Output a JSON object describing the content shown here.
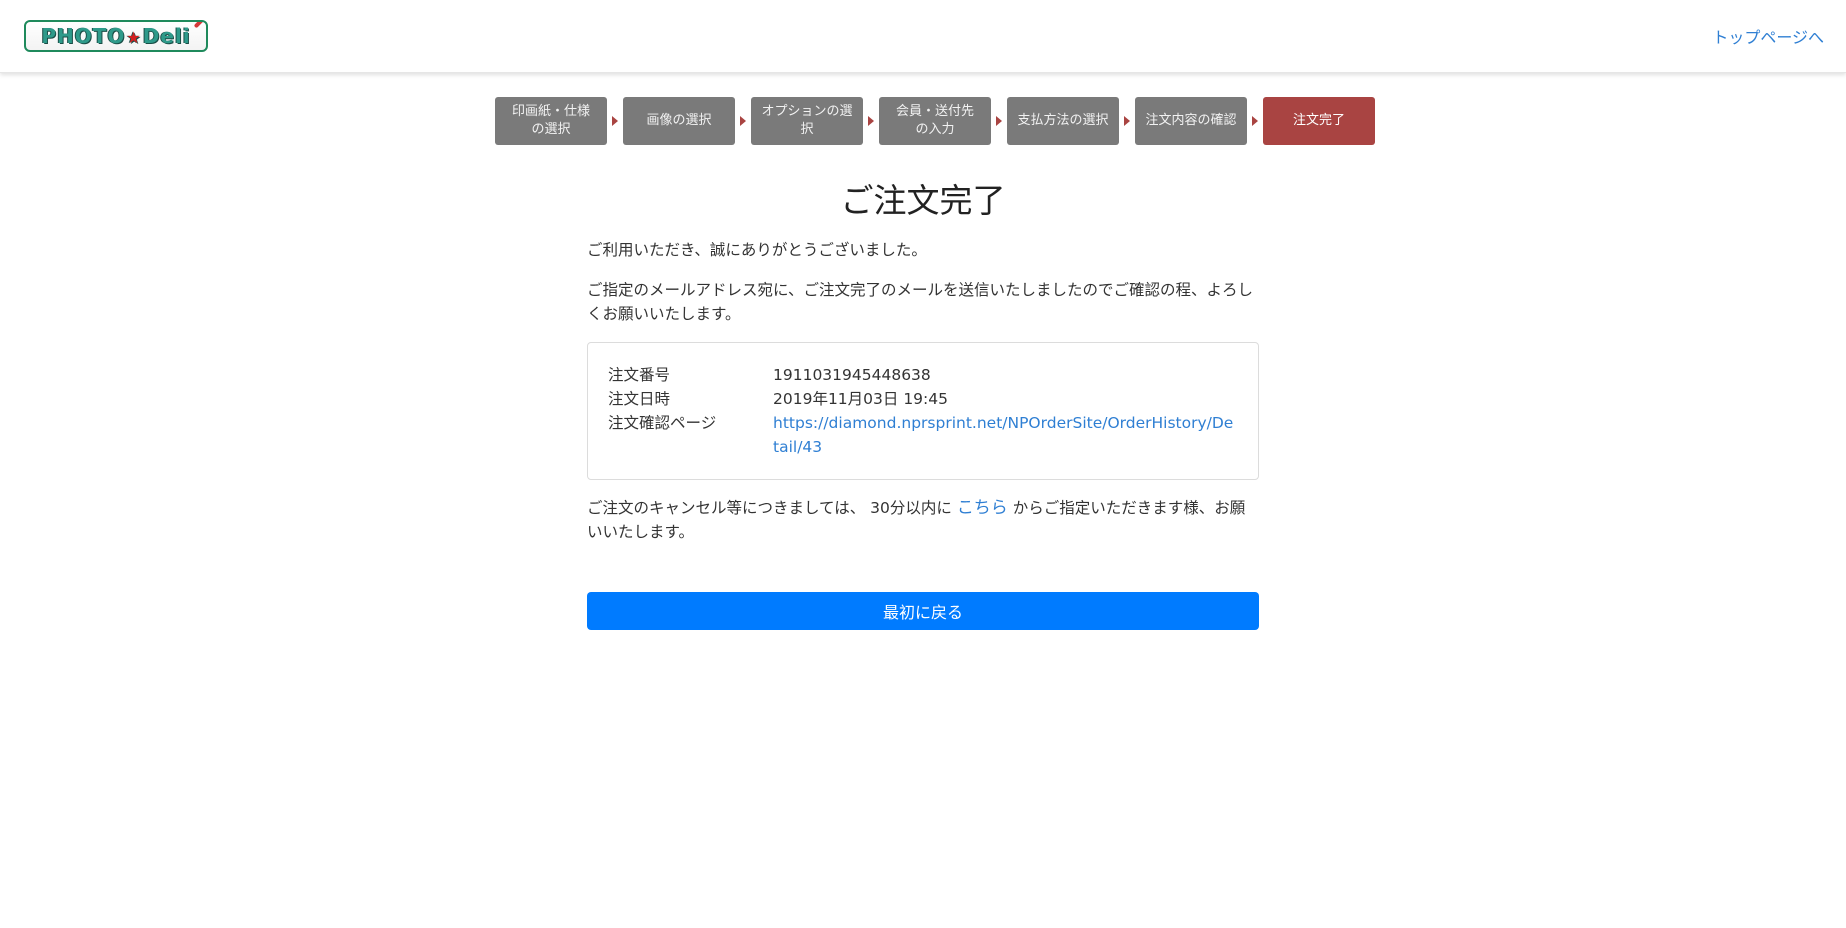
{
  "header": {
    "logo": {
      "text_left": "PHOTO",
      "star": "★",
      "text_right": "Deli",
      "icon": "pen-icon"
    },
    "top_link": "トップページへ"
  },
  "steps": [
    {
      "label": "印画紙・仕様\nの選択",
      "active": false
    },
    {
      "label": "画像の選択",
      "active": false
    },
    {
      "label": "オプションの選\n択",
      "active": false
    },
    {
      "label": "会員・送付先\nの入力",
      "active": false
    },
    {
      "label": "支払方法の選択",
      "active": false
    },
    {
      "label": "注文内容の確認",
      "active": false
    },
    {
      "label": "注文完了",
      "active": true
    }
  ],
  "main": {
    "title": "ご注文完了",
    "thanks": "ご利用いただき、誠にありがとうございました。",
    "email_notice": "ご指定のメールアドレス宛に、ご注文完了のメールを送信いたしましたのでご確認の程、よろしくお願いいたします。",
    "order": {
      "number_label": "注文番号",
      "number_value": "1911031945448638",
      "datetime_label": "注文日時",
      "datetime_value": "2019年11月03日 19:45",
      "page_label": "注文確認ページ",
      "page_url": "https://diamond.nprsprint.net/NPOrderSite/OrderHistory/Detail/43"
    },
    "cancel_prefix": "ご注文のキャンセル等につきましては、 30分以内に ",
    "cancel_link": "こちら",
    "cancel_suffix": " からご指定いただきます様、お願いいたします。",
    "back_button": "最初に戻る"
  },
  "colors": {
    "step_inactive": "#7a7a7a",
    "step_active": "#a94442",
    "primary": "#007bff",
    "link": "#2f7fd3"
  }
}
